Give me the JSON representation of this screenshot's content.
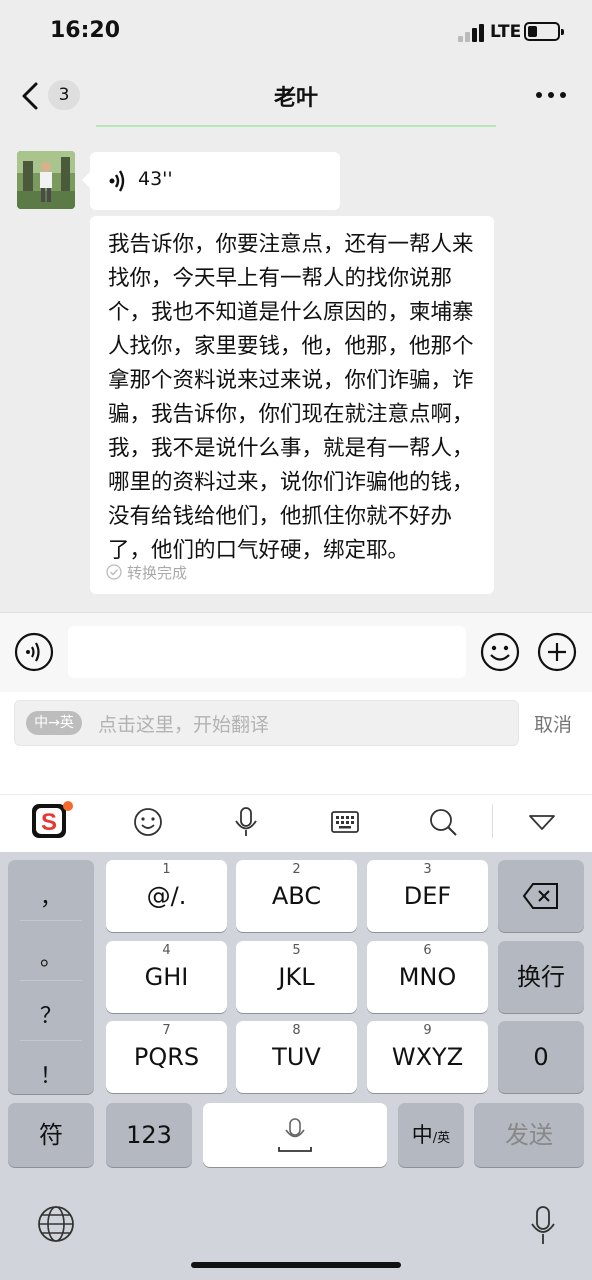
{
  "status": {
    "time": "16:20",
    "network": "LTE"
  },
  "nav": {
    "unread_count": "3",
    "title": "老叶"
  },
  "chat": {
    "voice_duration": "43''",
    "transcript": "我告诉你，你要注意点，还有一帮人来找你，今天早上有一帮人的找你说那个，我也不知道是什么原因的，柬埔寨人找你，家里要钱，他，他那，他那个拿那个资料说来过来说，你们诈骗，诈骗，我告诉你，你们现在就注意点啊，我，我不是说什么事，就是有一帮人，哪里的资料过来，说你们诈骗他的钱，没有给钱给他们，他抓住你就不好办了，他们的口气好硬，绑定耶。",
    "transcript_status": "转换完成"
  },
  "translate": {
    "lang_pill": "中→英",
    "placeholder": "点击这里，开始翻译",
    "cancel": "取消"
  },
  "keyboard": {
    "punct": [
      "，",
      "。",
      "？",
      "！"
    ],
    "keys": [
      {
        "num": "1",
        "label": "@/."
      },
      {
        "num": "2",
        "label": "ABC"
      },
      {
        "num": "3",
        "label": "DEF"
      },
      {
        "num": "4",
        "label": "GHI"
      },
      {
        "num": "5",
        "label": "JKL"
      },
      {
        "num": "6",
        "label": "MNO"
      },
      {
        "num": "7",
        "label": "PQRS"
      },
      {
        "num": "8",
        "label": "TUV"
      },
      {
        "num": "9",
        "label": "WXYZ"
      }
    ],
    "newline": "换行",
    "zero": "0",
    "symbols": "符",
    "numbers": "123",
    "lang_main": "中",
    "lang_sub": "/英",
    "send": "发送"
  },
  "colors": {
    "chat_bg": "#ededed",
    "keyboard_bg": "#d1d4da",
    "logo_red": "#e53935",
    "badge_orange": "#f26b2a"
  }
}
